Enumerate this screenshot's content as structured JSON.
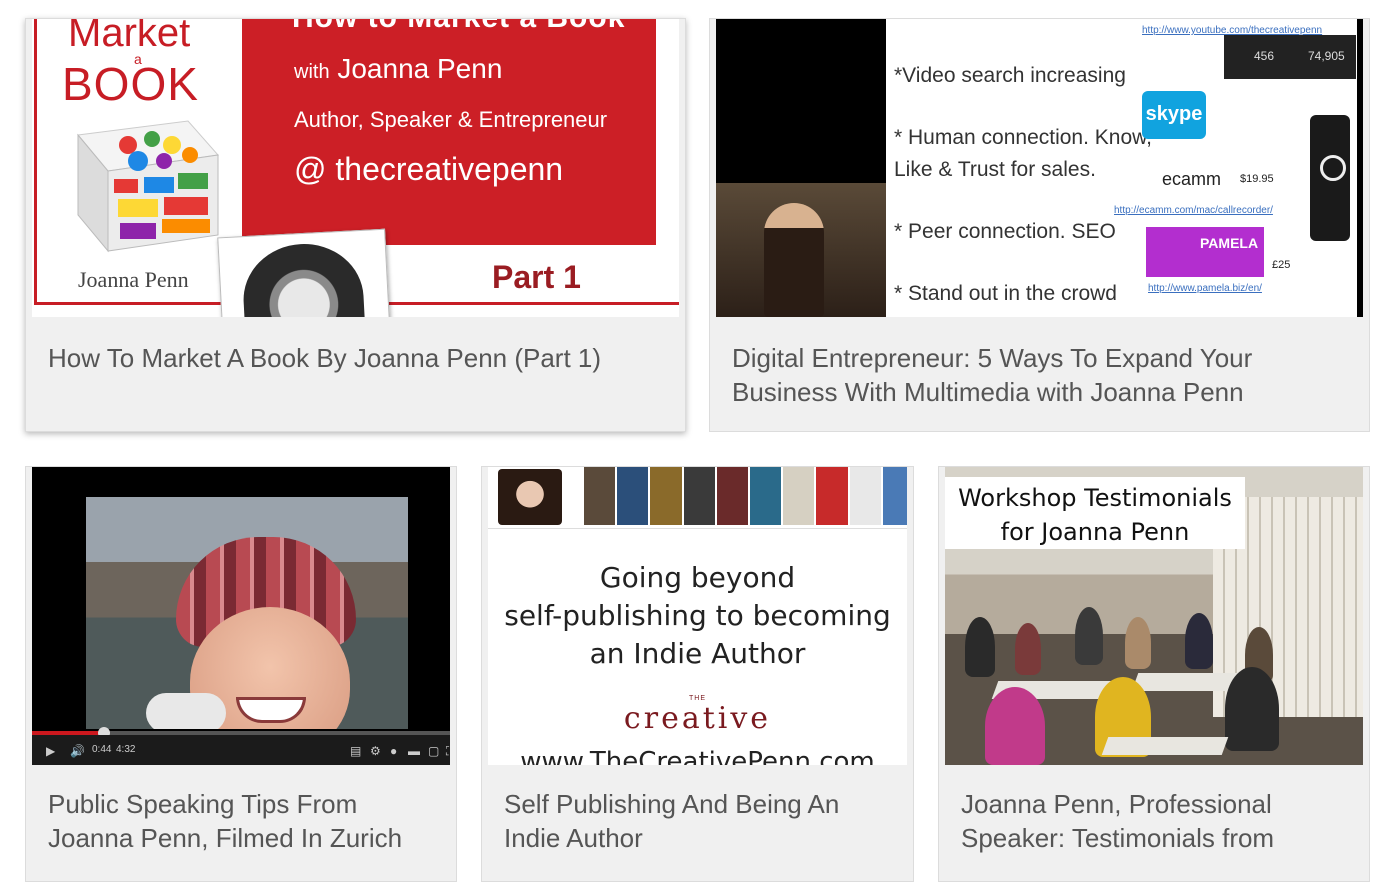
{
  "cards": [
    {
      "title": "How To Market A Book By Joanna Penn (Part 1)",
      "thumb": {
        "market": "Market",
        "a": "a",
        "book": "BOOK",
        "top_cut": "How to Market a Book",
        "with": "with",
        "name": "Joanna Penn",
        "role": "Author, Speaker & Entrepreneur",
        "handle": "@ thecreativepenn",
        "author": "Joanna Penn",
        "part": "Part 1"
      }
    },
    {
      "title": "Digital Entrepreneur: 5 Ways To Expand Your Business With Multimedia with Joanna Penn",
      "thumb": {
        "link_top": "http://www.youtube.com/thecreativepenn",
        "stat1": "456",
        "stat2": "74,905",
        "b1": "*Video search increasing",
        "b2a": "* Human connection. Know,",
        "b2b": "Like & Trust for sales.",
        "b3": "* Peer connection. SEO",
        "b4": "* Stand out in the crowd",
        "skype": "skype",
        "ecamm": "ecamm",
        "price1": "$19.95",
        "link_ecamm": "http://ecamm.com/mac/callrecorder/",
        "pamela": "PAMELA",
        "price2": "£25",
        "link_pamela": "http://www.pamela.biz/en/"
      }
    },
    {
      "title": "Public Speaking Tips From Joanna Penn, Filmed In Zurich",
      "thumb": {
        "time_current": "0:44",
        "time_total": "4:32",
        "progress": 0.17
      }
    },
    {
      "title": "Self Publishing And Being An Indie Author",
      "thumb": {
        "line1": "Going beyond",
        "line2": "self-publishing to becoming",
        "line3": "an Indie Author",
        "logo_the": "THE",
        "logo": "creative",
        "url": "www.TheCreativePenn.com"
      }
    },
    {
      "title": "Joanna Penn, Professional Speaker: Testimonials from",
      "thumb": {
        "caption1": "Workshop Testimonials",
        "caption2": "for Joanna Penn"
      }
    }
  ],
  "colors": {
    "card_bg": "#f0f0f0",
    "title": "#555555",
    "brand_red": "#cc1f26"
  }
}
